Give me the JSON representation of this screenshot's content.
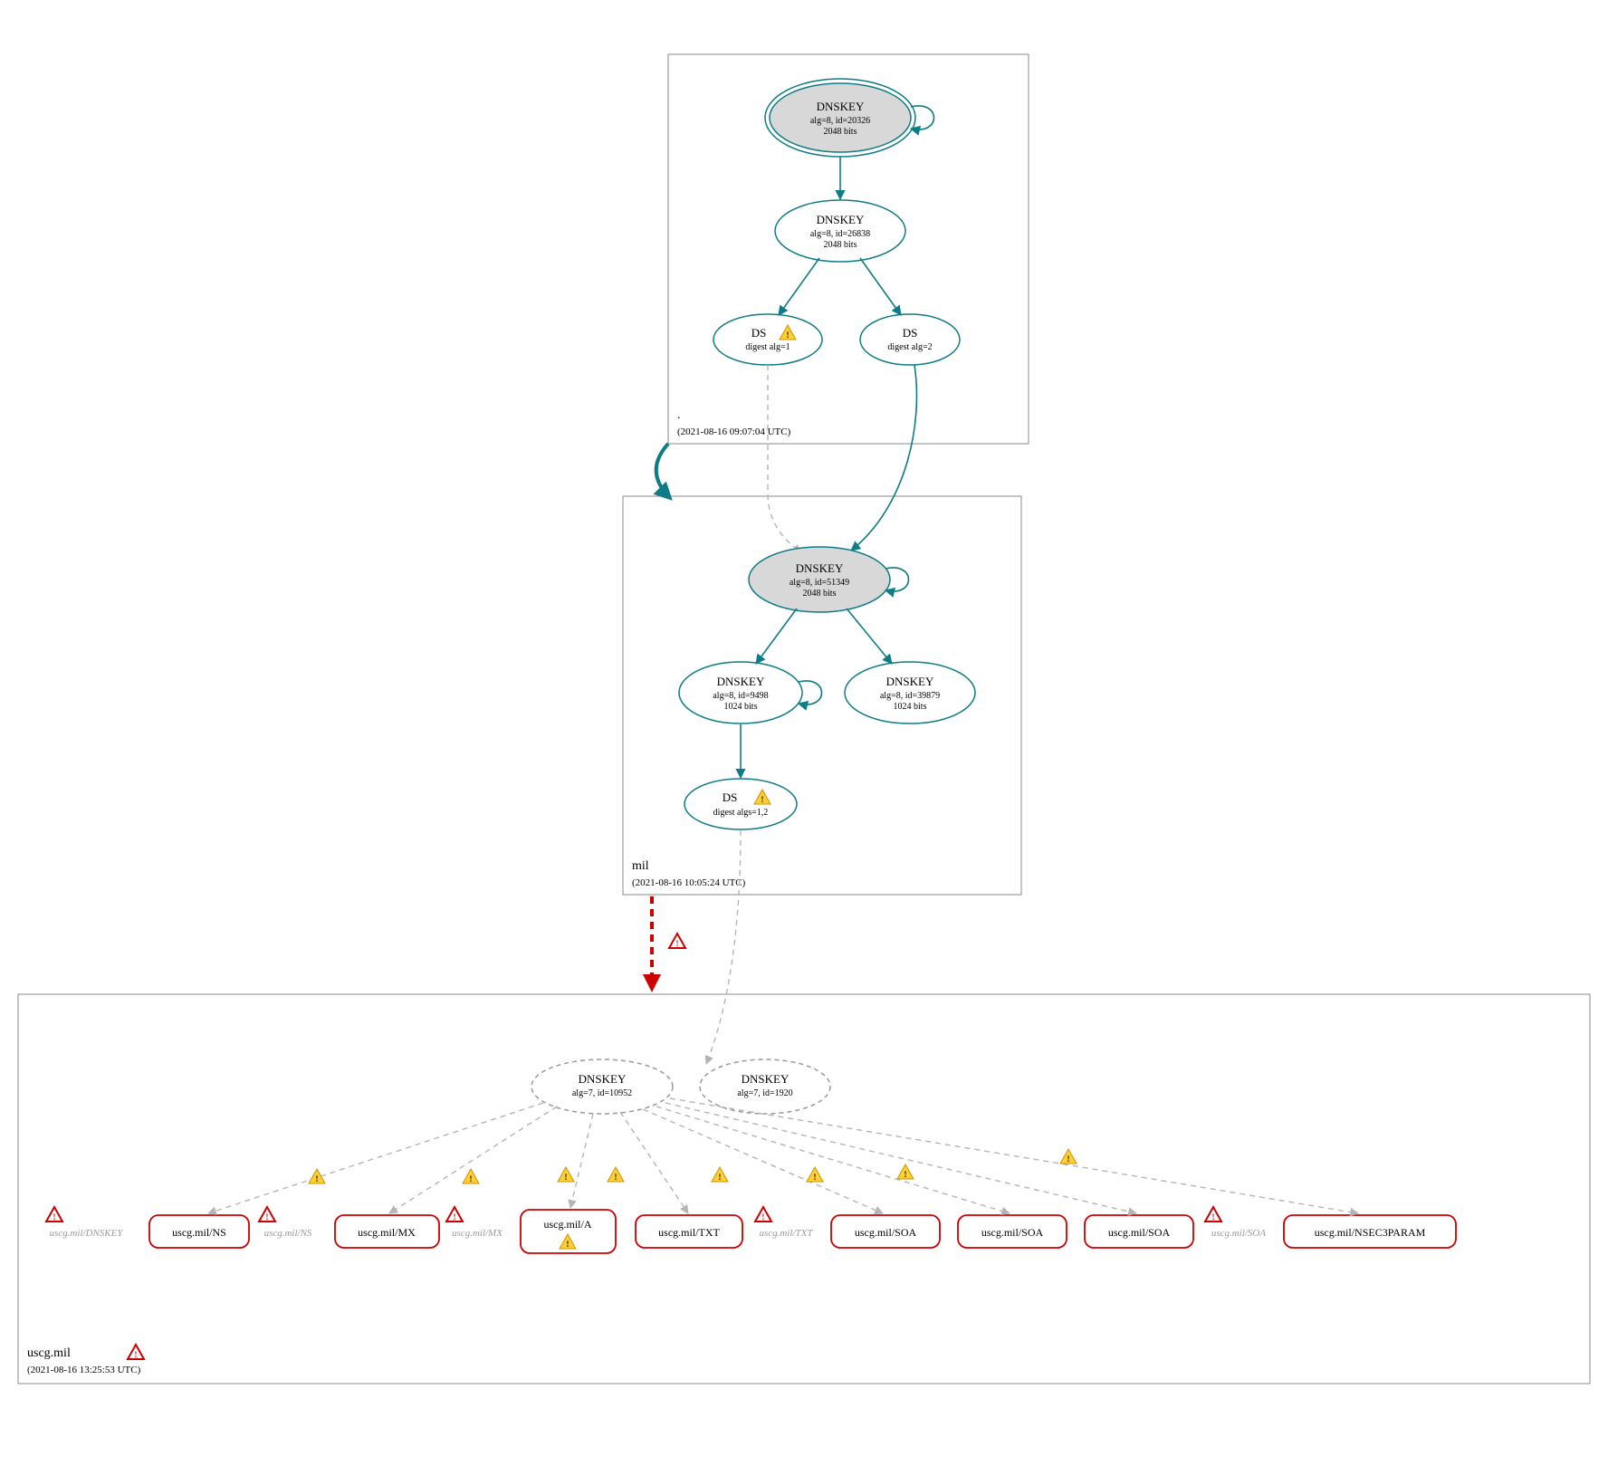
{
  "zones": {
    "root": {
      "label": ".",
      "timestamp": "(2021-08-16 09:07:04 UTC)"
    },
    "mil": {
      "label": "mil",
      "timestamp": "(2021-08-16 10:05:24 UTC)"
    },
    "uscg": {
      "label": "uscg.mil",
      "timestamp": "(2021-08-16 13:25:53 UTC)"
    }
  },
  "nodes": {
    "root_ksk": {
      "title": "DNSKEY",
      "line2": "alg=8, id=20326",
      "line3": "2048 bits"
    },
    "root_zsk": {
      "title": "DNSKEY",
      "line2": "alg=8, id=26838",
      "line3": "2048 bits"
    },
    "root_ds1": {
      "title": "DS",
      "line2": "digest alg=1"
    },
    "root_ds2": {
      "title": "DS",
      "line2": "digest alg=2"
    },
    "mil_ksk": {
      "title": "DNSKEY",
      "line2": "alg=8, id=51349",
      "line3": "2048 bits"
    },
    "mil_zsk1": {
      "title": "DNSKEY",
      "line2": "alg=8, id=9498",
      "line3": "1024 bits"
    },
    "mil_zsk2": {
      "title": "DNSKEY",
      "line2": "alg=8, id=39879",
      "line3": "1024 bits"
    },
    "mil_ds": {
      "title": "DS",
      "line2": "digest algs=1,2"
    },
    "uscg_key1": {
      "title": "DNSKEY",
      "line2": "alg=7, id=10952"
    },
    "uscg_key2": {
      "title": "DNSKEY",
      "line2": "alg=7, id=1920"
    }
  },
  "ghosts": {
    "g_dnskey": "uscg.mil/DNSKEY",
    "g_ns": "uscg.mil/NS",
    "g_mx": "uscg.mil/MX",
    "g_txt": "uscg.mil/TXT",
    "g_soa": "uscg.mil/SOA"
  },
  "rr": {
    "ns": "uscg.mil/NS",
    "mx": "uscg.mil/MX",
    "a": "uscg.mil/A",
    "txt": "uscg.mil/TXT",
    "soa1": "uscg.mil/SOA",
    "soa2": "uscg.mil/SOA",
    "soa3": "uscg.mil/SOA",
    "nsec3": "uscg.mil/NSEC3PARAM"
  }
}
